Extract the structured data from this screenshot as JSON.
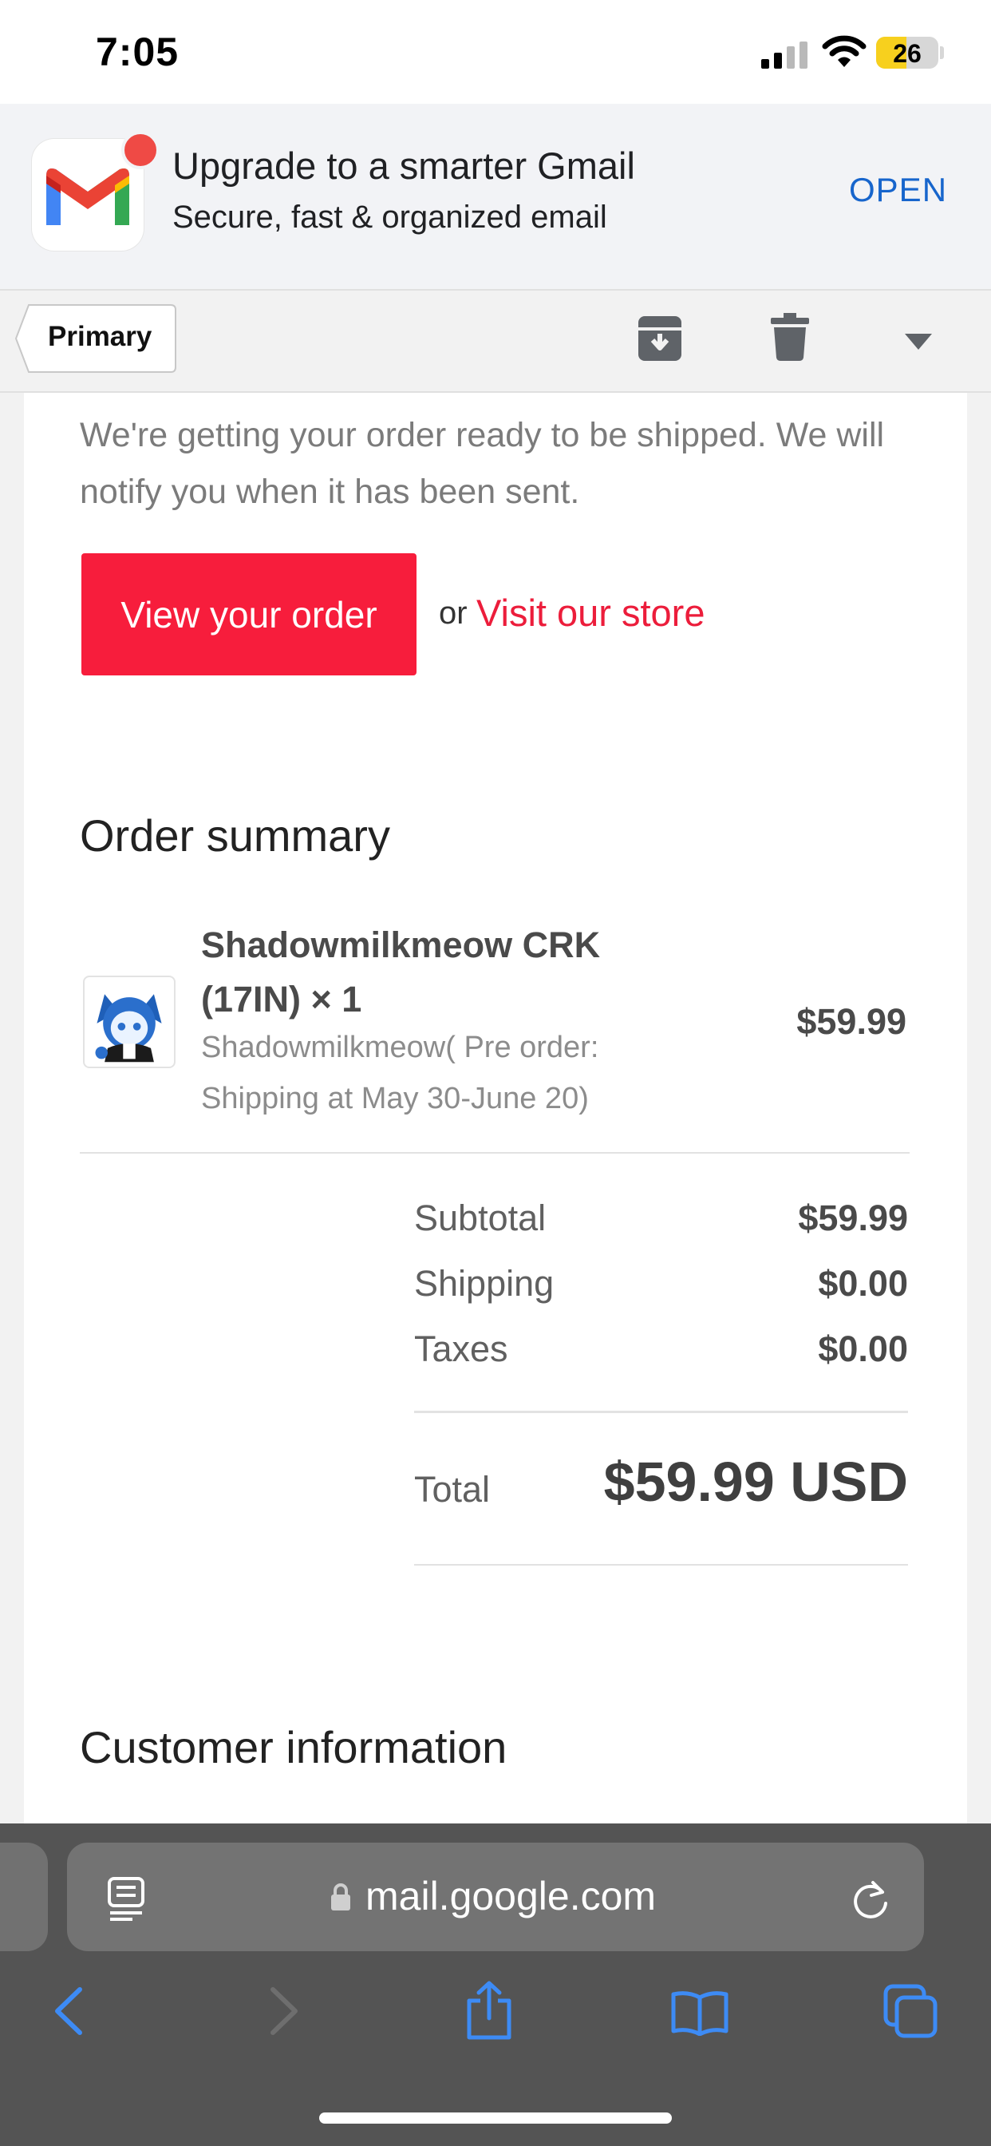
{
  "status_bar": {
    "time": "7:05",
    "battery": "26"
  },
  "banner": {
    "title": "Upgrade to a smarter Gmail",
    "subtitle": "Secure, fast & organized email",
    "open_label": "OPEN"
  },
  "toolbar": {
    "back_label": "Primary",
    "icons": [
      "archive-icon",
      "trash-icon",
      "caret-down-icon"
    ]
  },
  "email": {
    "intro": "We're getting your order ready to be shipped. We will notify you when it has been sent.",
    "view_order_label": "View your order",
    "or_text": "or",
    "visit_store_label": "Visit our store",
    "order_summary_title": "Order summary",
    "item": {
      "name": "Shadowmilkmeow CRK (17IN) × 1",
      "variant": "Shadowmilkmeow( Pre order: Shipping at May 30-June 20)",
      "price": "$59.99"
    },
    "summary": [
      {
        "label": "Subtotal",
        "value": "$59.99"
      },
      {
        "label": "Shipping",
        "value": "$0.00"
      },
      {
        "label": "Taxes",
        "value": "$0.00"
      }
    ],
    "total_label": "Total",
    "total_value": "$59.99 USD",
    "customer_info_title": "Customer information"
  },
  "safari": {
    "url": "mail.google.com",
    "icons": [
      "reader-icon",
      "lock-icon",
      "reload-icon",
      "back-icon",
      "forward-icon",
      "share-icon",
      "bookmarks-icon",
      "tabs-icon"
    ]
  },
  "colors": {
    "accent_red": "#f71d3c",
    "link_blue": "#1765cc",
    "safari_bar": "#545454"
  }
}
